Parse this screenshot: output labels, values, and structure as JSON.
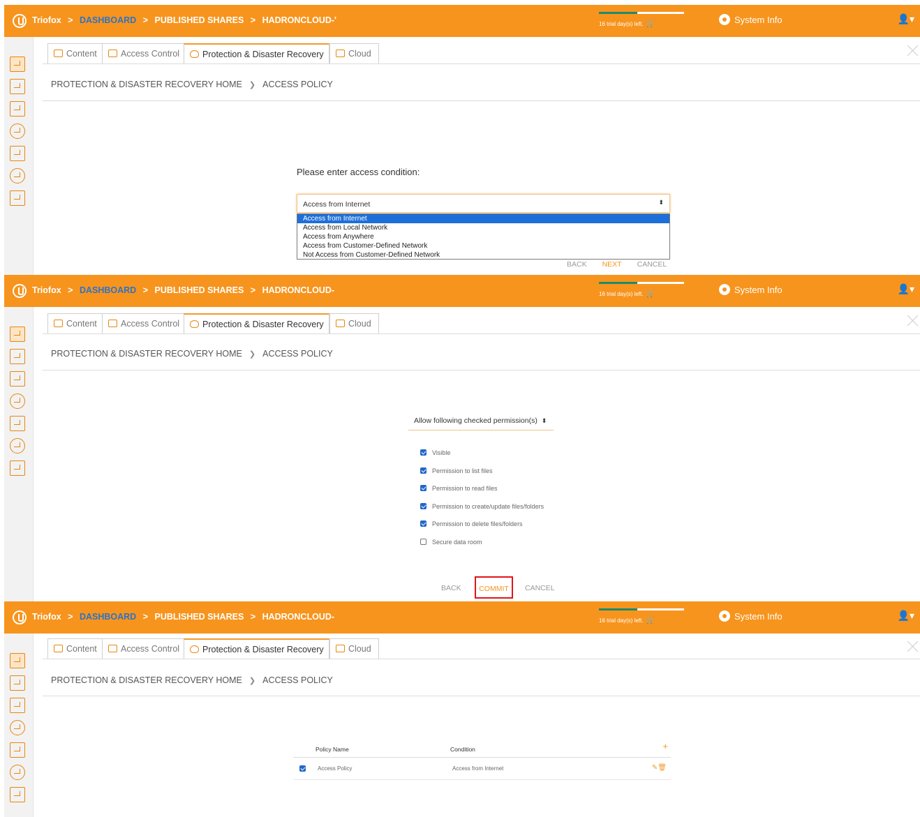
{
  "topbar": {
    "brand": "Triofox",
    "sep": ">",
    "crumb_dashboard": "DASHBOARD",
    "crumb_published": "PUBLISHED SHARES",
    "crumb_share": "HADRONCLOUD-",
    "crumb_share_p1": "HADRONCLOUD-'",
    "trial_text": "16 trial day(s) left.",
    "trial_progress": 0.45,
    "system_info": "System Info"
  },
  "tabs": {
    "content": "Content",
    "access_control": "Access Control",
    "protection": "Protection & Disaster Recovery",
    "cloud": "Cloud"
  },
  "breadcrumb": {
    "home": "PROTECTION & DISASTER RECOVERY HOME",
    "current": "ACCESS POLICY"
  },
  "panel1": {
    "prompt": "Please enter access condition:",
    "selected": "Access from Internet",
    "options": [
      "Access from Internet",
      "Access from Local Network",
      "Access from Anywhere",
      "Access from Customer-Defined Network",
      "Not Access from Customer-Defined Network"
    ],
    "back": "BACK",
    "next": "NEXT",
    "cancel": "CANCEL"
  },
  "panel2": {
    "permission_mode": "Allow following checked permission(s)",
    "permissions": [
      {
        "label": "Visible",
        "checked": true
      },
      {
        "label": "Permission to list files",
        "checked": true
      },
      {
        "label": "Permission to read files",
        "checked": true
      },
      {
        "label": "Permission to create/update files/folders",
        "checked": true
      },
      {
        "label": "Permission to delete files/folders",
        "checked": true
      },
      {
        "label": "Secure data room",
        "checked": false
      }
    ],
    "back": "BACK",
    "commit": "COMMIT",
    "cancel": "CANCEL"
  },
  "panel3": {
    "col_policy": "Policy Name",
    "col_condition": "Condition",
    "add": "+",
    "rows": [
      {
        "checked": true,
        "policy": "Access Policy",
        "condition": "Access from Internet"
      }
    ]
  },
  "colors": {
    "accent": "#f7941d",
    "link_blue": "#2b73c9",
    "highlight_red": "#e0141c"
  }
}
